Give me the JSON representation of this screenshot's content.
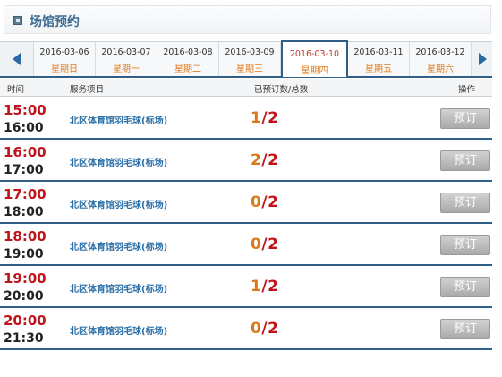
{
  "header": {
    "title": "场馆预约",
    "icon": "panel-icon"
  },
  "dates": [
    {
      "date": "2016-03-06",
      "weekday": "星期日",
      "active": false
    },
    {
      "date": "2016-03-07",
      "weekday": "星期一",
      "active": false
    },
    {
      "date": "2016-03-08",
      "weekday": "星期二",
      "active": false
    },
    {
      "date": "2016-03-09",
      "weekday": "星期三",
      "active": false
    },
    {
      "date": "2016-03-10",
      "weekday": "星期四",
      "active": true
    },
    {
      "date": "2016-03-11",
      "weekday": "星期五",
      "active": false
    },
    {
      "date": "2016-03-12",
      "weekday": "星期六",
      "active": false
    }
  ],
  "table": {
    "headers": {
      "time": "时间",
      "service": "服务项目",
      "count": "已预订数/总数",
      "action": "操作"
    },
    "rows": [
      {
        "start": "15:00",
        "end": "16:00",
        "service": "北区体育馆羽毛球(标场)",
        "booked": "1",
        "total": "2",
        "button": "预订"
      },
      {
        "start": "16:00",
        "end": "17:00",
        "service": "北区体育馆羽毛球(标场)",
        "booked": "2",
        "total": "2",
        "button": "预订"
      },
      {
        "start": "17:00",
        "end": "18:00",
        "service": "北区体育馆羽毛球(标场)",
        "booked": "0",
        "total": "2",
        "button": "预订"
      },
      {
        "start": "18:00",
        "end": "19:00",
        "service": "北区体育馆羽毛球(标场)",
        "booked": "0",
        "total": "2",
        "button": "预订"
      },
      {
        "start": "19:00",
        "end": "20:00",
        "service": "北区体育馆羽毛球(标场)",
        "booked": "1",
        "total": "2",
        "button": "预订"
      },
      {
        "start": "20:00",
        "end": "21:30",
        "service": "北区体育馆羽毛球(标场)",
        "booked": "0",
        "total": "2",
        "button": "预订"
      }
    ]
  },
  "colors": {
    "accent": "#2f5f86",
    "start_time": "#c0141c",
    "booked": "#d97a1a",
    "weekday": "#e07b1f"
  }
}
